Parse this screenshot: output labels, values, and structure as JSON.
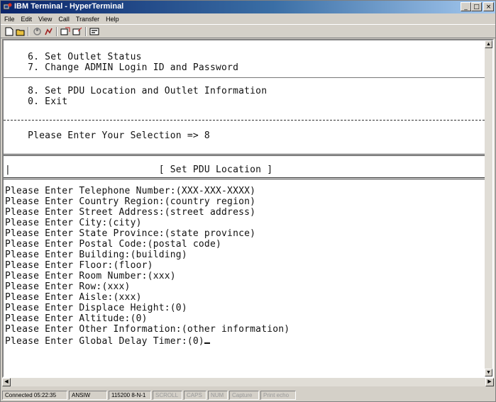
{
  "window": {
    "title": "IBM Terminal - HyperTerminal"
  },
  "menu": [
    "File",
    "Edit",
    "View",
    "Call",
    "Transfer",
    "Help"
  ],
  "toolbar": {
    "icons": [
      "new-icon",
      "open-icon",
      "connect-icon",
      "disconnect-icon",
      "send-icon",
      "receive-icon",
      "properties-icon"
    ]
  },
  "terminal": {
    "lines": [
      "    6. Set Outlet Status",
      "    7. Change ADMIN Login ID and Password",
      "    8. Set PDU Location and Outlet Information",
      "    0. Exit",
      "    Please Enter Your Selection => 8",
      "|                          [ Set PDU Location ]",
      "Please Enter Telephone Number:(XXX-XXX-XXXX)",
      "Please Enter Country Region:(country region)",
      "Please Enter Street Address:(street address)",
      "Please Enter City:(city)",
      "Please Enter State Province:(state province)",
      "Please Enter Postal Code:(postal code)",
      "Please Enter Building:(building)",
      "Please Enter Floor:(floor)",
      "Please Enter Room Number:(xxx)",
      "Please Enter Row:(xxx)",
      "Please Enter Aisle:(xxx)",
      "Please Enter Displace Height:(0)",
      "Please Enter Altitude:(0)",
      "Please Enter Other Information:(other information)",
      "Please Enter Global Delay Timer:(0)"
    ]
  },
  "status": {
    "connected": "Connected 05:22:35",
    "emulation": "ANSIW",
    "settings": "115200 8-N-1",
    "scroll": "SCROLL",
    "caps": "CAPS",
    "num": "NUM",
    "capture": "Capture",
    "print_echo": "Print echo"
  },
  "colors": {
    "title_bar": "#0a246a",
    "window_face": "#d4d0c8",
    "terminal_bg": "#ffffff",
    "terminal_text": "#111111"
  }
}
